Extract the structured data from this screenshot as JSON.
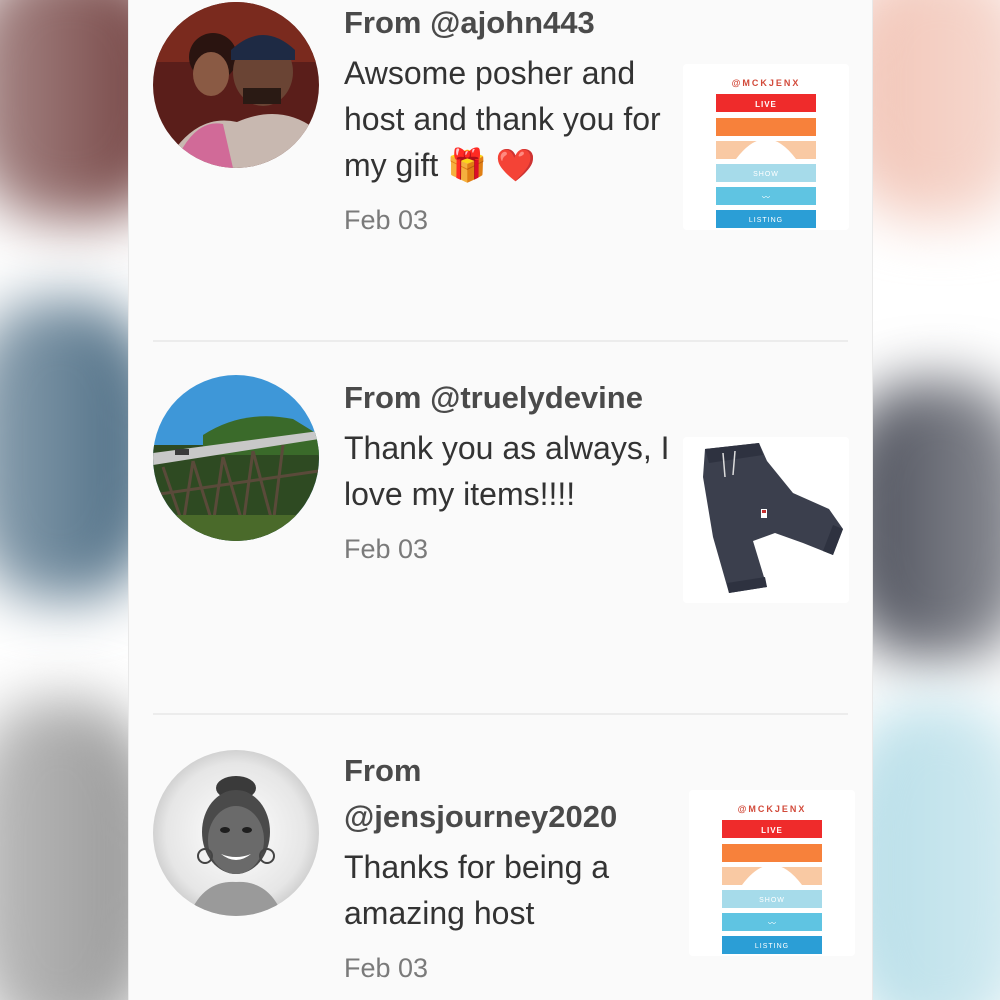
{
  "feed": {
    "items": [
      {
        "from": "From @ajohn443",
        "message": "Awsome posher and host and thank you for my gift 🎁 ❤️",
        "date": "Feb 03",
        "thumb": {
          "handle": "@MCKJENX",
          "live": "LIVE",
          "show": "SHOW",
          "wave": "〰",
          "listing": "LISTING"
        }
      },
      {
        "from": "From @truelydevine",
        "message": "Thank you as always, I love my items!!!!",
        "date": "Feb 03"
      },
      {
        "from": "From @jensjourney2020",
        "message": "Thanks for being a amazing host",
        "date": "Feb 03",
        "thumb": {
          "handle": "@MCKJENX",
          "live": "LIVE",
          "show": "SHOW",
          "wave": "〰",
          "listing": "LISTING"
        }
      }
    ]
  },
  "colors": {
    "live_red": "#ef2b2b",
    "orange": "#f7813b",
    "peach": "#f9c9a3",
    "light_blue": "#a6dbea",
    "mid_blue": "#5fc4e2",
    "blue": "#2b9ed6"
  },
  "icons": [
    "gift-icon",
    "heart-icon"
  ]
}
